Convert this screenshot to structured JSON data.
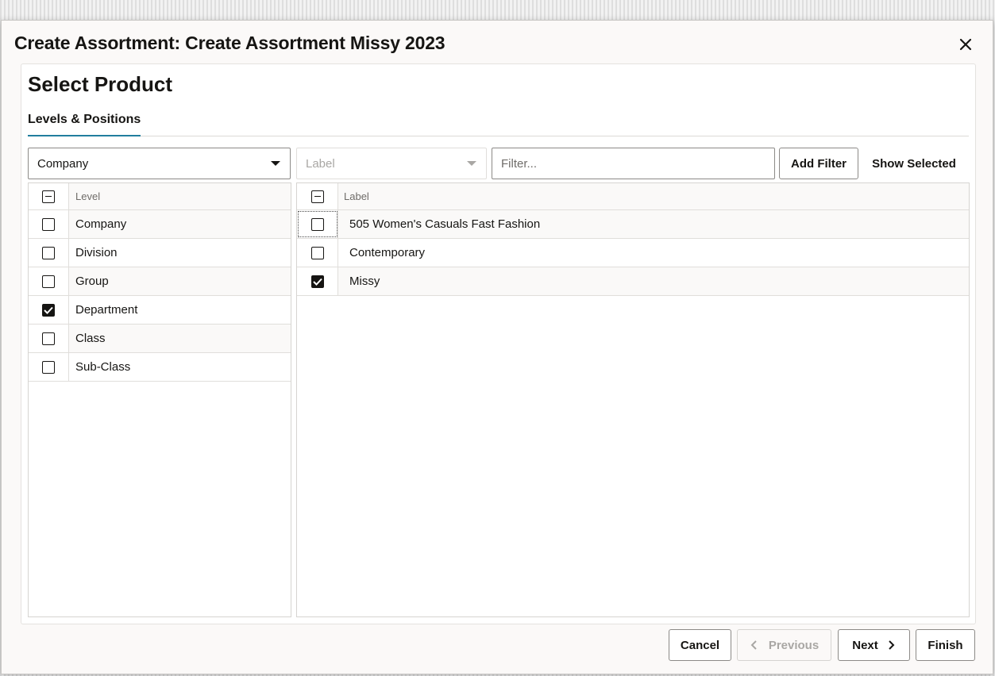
{
  "dialog": {
    "title": "Create Assortment: Create Assortment Missy 2023",
    "close_icon": "close-icon"
  },
  "panel": {
    "title": "Select Product",
    "tabs": [
      {
        "label": "Levels & Positions",
        "active": true
      }
    ]
  },
  "toolbar": {
    "level_select_value": "Company",
    "label_select_placeholder": "Label",
    "filter_placeholder": "Filter...",
    "add_filter_label": "Add Filter",
    "show_selected_label": "Show Selected"
  },
  "levels_grid": {
    "header": "Level",
    "header_checkbox": "partial",
    "rows": [
      {
        "label": "Company",
        "checked": false
      },
      {
        "label": "Division",
        "checked": false
      },
      {
        "label": "Group",
        "checked": false
      },
      {
        "label": "Department",
        "checked": true
      },
      {
        "label": "Class",
        "checked": false
      },
      {
        "label": "Sub-Class",
        "checked": false
      }
    ]
  },
  "positions_grid": {
    "header": "Label",
    "header_checkbox": "partial",
    "rows": [
      {
        "label": "505 Women's Casuals Fast Fashion",
        "checked": false
      },
      {
        "label": "Contemporary",
        "checked": false
      },
      {
        "label": "Missy",
        "checked": true
      }
    ]
  },
  "footer": {
    "cancel_label": "Cancel",
    "previous_label": "Previous",
    "next_label": "Next",
    "finish_label": "Finish"
  },
  "colors": {
    "tab_underline": "#227e9e",
    "text": "#161513",
    "disabled_text": "#a9a7a4"
  }
}
